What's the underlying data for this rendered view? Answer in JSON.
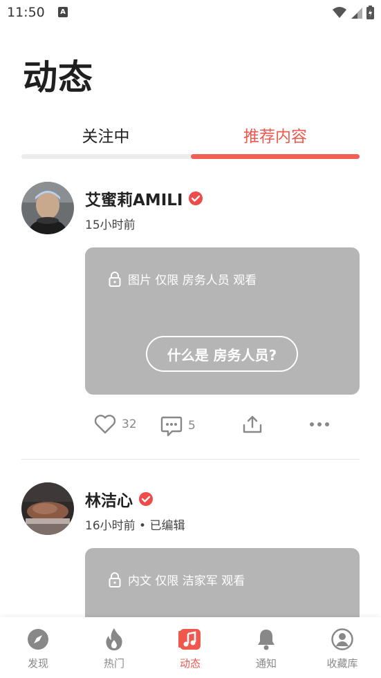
{
  "status_bar": {
    "time": "11:50",
    "notification_icon": "A"
  },
  "page": {
    "title": "动态"
  },
  "tabs": [
    {
      "label": "关注中",
      "active": false
    },
    {
      "label": "推荐内容",
      "active": true
    }
  ],
  "posts": [
    {
      "author": "艾蜜莉AMILI",
      "verified": true,
      "time": "15小时前",
      "locked_text": "图片 仅限 房务人员 观看",
      "button_label": "什么是 房务人员?",
      "likes": "32",
      "comments": "5"
    },
    {
      "author": "林洁心",
      "verified": true,
      "time": "16小时前 • 已编辑",
      "locked_text": "内文 仅限 洁家军 观看"
    }
  ],
  "bottom_nav": [
    {
      "label": "发现",
      "icon": "compass-icon"
    },
    {
      "label": "热门",
      "icon": "flame-icon"
    },
    {
      "label": "动态",
      "icon": "music-note-icon",
      "active": true
    },
    {
      "label": "通知",
      "icon": "bell-icon"
    },
    {
      "label": "收藏库",
      "icon": "profile-icon"
    }
  ],
  "colors": {
    "accent": "#f0584e",
    "locked_bg": "#b5b5b5",
    "verified": "#f04b4b"
  }
}
